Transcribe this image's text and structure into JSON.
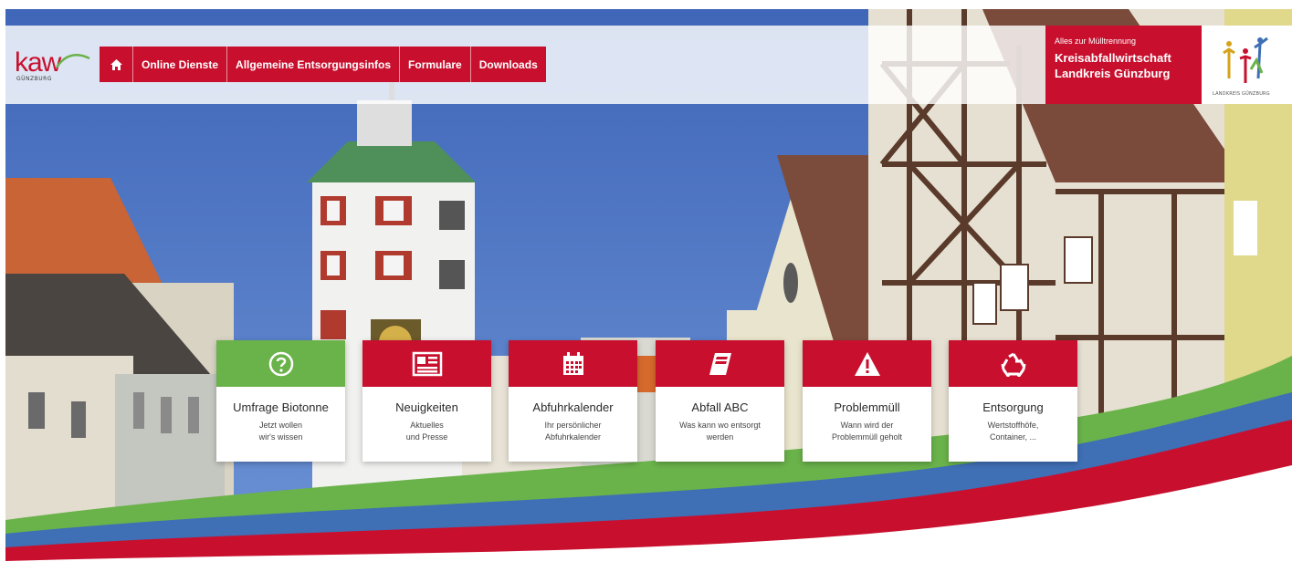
{
  "header": {
    "logo": {
      "word": "kaw",
      "sub": "GÜNZBURG"
    },
    "nav": [
      {
        "label": "",
        "icon": "home-icon"
      },
      {
        "label": "Online Dienste"
      },
      {
        "label": "Allgemeine Entsorgungsinfos"
      },
      {
        "label": "Formulare"
      },
      {
        "label": "Downloads"
      }
    ],
    "brand": {
      "tagline": "Alles zur Mülltrennung",
      "line1": "Kreisabfallwirtschaft",
      "line2": "Landkreis Günzburg"
    },
    "district_logo_caption": "LANDKREIS GÜNZBURG"
  },
  "tiles": [
    {
      "title": "Umfrage Biotonne",
      "desc1": "Jetzt wollen",
      "desc2": "wir's wissen",
      "icon": "question-circle-icon",
      "color": "#6ab24a"
    },
    {
      "title": "Neuigkeiten",
      "desc1": "Aktuelles",
      "desc2": "und Presse",
      "icon": "newspaper-icon",
      "color": "#c8102e"
    },
    {
      "title": "Abfuhrkalender",
      "desc1": "Ihr persönlicher",
      "desc2": "Abfuhrkalender",
      "icon": "calendar-icon",
      "color": "#c8102e"
    },
    {
      "title": "Abfall ABC",
      "desc1": "Was kann wo entsorgt",
      "desc2": "werden",
      "icon": "book-icon",
      "color": "#c8102e"
    },
    {
      "title": "Problemmüll",
      "desc1": "Wann wird der",
      "desc2": "Problemmüll geholt",
      "icon": "warning-icon",
      "color": "#c8102e"
    },
    {
      "title": "Entsorgung",
      "desc1": "Wertstoffhöfe,",
      "desc2": "Container, ...",
      "icon": "recycle-icon",
      "color": "#c8102e"
    }
  ],
  "colors": {
    "brand_red": "#c8102e",
    "green": "#6ab24a",
    "blue_wave": "#3f6fb5"
  }
}
